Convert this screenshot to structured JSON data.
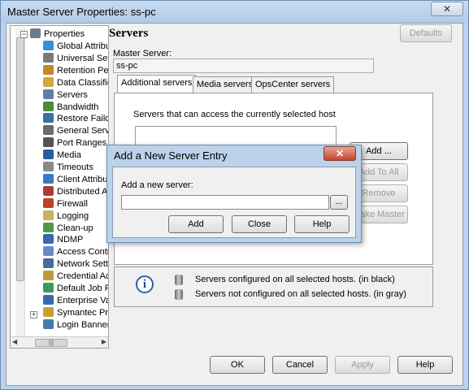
{
  "window": {
    "title": "Master Server Properties: ss-pc",
    "close_glyph": "✕"
  },
  "tree": {
    "root": "Properties",
    "items": [
      {
        "label": "Global Attribut",
        "icon": "globe-icon",
        "color": "#3a8fd0"
      },
      {
        "label": "Universal Setti",
        "icon": "settings-icon",
        "color": "#7a7a7a"
      },
      {
        "label": "Retention Peri",
        "icon": "clock-icon",
        "color": "#c08a2a"
      },
      {
        "label": "Data Classifica",
        "icon": "classification-icon",
        "color": "#d1a83a"
      },
      {
        "label": "Servers",
        "icon": "server-icon",
        "color": "#5b7fa8"
      },
      {
        "label": "Bandwidth",
        "icon": "bandwidth-icon",
        "color": "#4c8a3c"
      },
      {
        "label": "Restore Failov",
        "icon": "restore-icon",
        "color": "#3c6ea8"
      },
      {
        "label": "General Serve",
        "icon": "server-icon",
        "color": "#6a6a6a"
      },
      {
        "label": "Port Ranges",
        "icon": "port-icon",
        "color": "#555555"
      },
      {
        "label": "Media",
        "icon": "media-icon",
        "color": "#2b5d9a"
      },
      {
        "label": "Timeouts",
        "icon": "timer-icon",
        "color": "#8a8a8a"
      },
      {
        "label": "Client Attribute",
        "icon": "client-icon",
        "color": "#3a7ac4"
      },
      {
        "label": "Distributed Ap",
        "icon": "distributed-icon",
        "color": "#b03a3a"
      },
      {
        "label": "Firewall",
        "icon": "firewall-icon",
        "color": "#c0402a"
      },
      {
        "label": "Logging",
        "icon": "logging-icon",
        "color": "#c8b45a"
      },
      {
        "label": "Clean-up",
        "icon": "cleanup-icon",
        "color": "#4a9a4a"
      },
      {
        "label": "NDMP",
        "icon": "ndmp-icon",
        "color": "#3a6aa8"
      },
      {
        "label": "Access Contro",
        "icon": "access-control-icon",
        "color": "#6a8ac8"
      },
      {
        "label": "Network Settin",
        "icon": "network-icon",
        "color": "#4a6a9a"
      },
      {
        "label": "Credential Acc",
        "icon": "credential-icon",
        "color": "#c09a3a"
      },
      {
        "label": "Default Job Pri",
        "icon": "job-priority-icon",
        "color": "#3a9a5a"
      },
      {
        "label": "Enterprise Vau",
        "icon": "vault-icon",
        "color": "#3a6ab0"
      },
      {
        "label": "Symantec Prod",
        "icon": "product-icon",
        "color": "#c8a030"
      },
      {
        "label": "Login Banner C",
        "icon": "banner-icon",
        "color": "#4a7ab0"
      }
    ]
  },
  "pane": {
    "title": "Servers",
    "defaults_label": "Defaults",
    "master_server_label": "Master Server:",
    "master_server_value": "ss-pc",
    "tabs": [
      "Additional servers",
      "Media servers",
      "OpsCenter servers"
    ],
    "list_caption": "Servers that can access the currently selected host",
    "side_buttons": [
      "Add ...",
      "Add To All",
      "Remove",
      "Make Master"
    ],
    "legend_black": "Servers configured on all selected hosts. (in black)",
    "legend_gray": "Servers not configured on all selected hosts. (in gray)",
    "info_glyph": "i"
  },
  "footer": {
    "ok": "OK",
    "cancel": "Cancel",
    "apply": "Apply",
    "help": "Help"
  },
  "dialog": {
    "title": "Add a New Server Entry",
    "close_glyph": "✕",
    "prompt": "Add a new server:",
    "input_value": "",
    "browse_label": "...",
    "add": "Add",
    "close": "Close",
    "help": "Help"
  }
}
